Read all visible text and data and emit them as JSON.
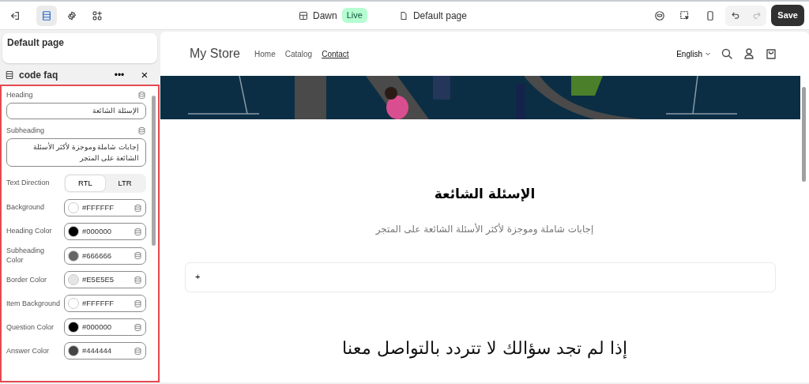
{
  "topbar": {
    "tools": [
      {
        "kind": "exit",
        "selected": false
      },
      {
        "kind": "sections",
        "selected": true
      },
      {
        "kind": "settings",
        "selected": false
      },
      {
        "kind": "apps",
        "selected": false
      }
    ],
    "theme": {
      "name": "Dawn",
      "badge": "Live"
    },
    "page": "Default page",
    "undo": {
      "disabled": false
    },
    "redo": {
      "disabled": true
    },
    "save": "Save"
  },
  "sidebar": {
    "page_title": "Default page",
    "section": {
      "title": "code faq",
      "menu": "•••",
      "close": "×"
    },
    "settings": [
      {
        "kind": "text",
        "label": "Heading",
        "value": "الإسئلة الشائعة"
      },
      {
        "kind": "textarea",
        "label": "Subheading",
        "value": "إجابات شاملة وموجزة لأكثر الأسئلة الشائعة على المتجر"
      },
      {
        "kind": "toggle",
        "label": "Text Direction",
        "options": [
          {
            "label": "RTL",
            "selected": true
          },
          {
            "label": "LTR",
            "selected": false
          }
        ]
      },
      {
        "kind": "color",
        "label": "Background",
        "value": "#FFFFFF",
        "color": "#ffffff"
      },
      {
        "kind": "color",
        "label": "Heading Color",
        "value": "#000000",
        "color": "#000000"
      },
      {
        "kind": "color",
        "label": "Subheading Color",
        "value": "#666666",
        "color": "#666666"
      },
      {
        "kind": "color",
        "label": "Border Color",
        "value": "#E5E5E5",
        "color": "#e5e5e5"
      },
      {
        "kind": "color",
        "label": "Item Background",
        "value": "#FFFFFF",
        "color": "#ffffff"
      },
      {
        "kind": "color",
        "label": "Question Color",
        "value": "#000000",
        "color": "#000000"
      },
      {
        "kind": "color",
        "label": "Answer Color",
        "value": "#444444",
        "color": "#444444"
      }
    ]
  },
  "preview": {
    "logo": "My Store",
    "nav": [
      {
        "label": "Home",
        "selected": false
      },
      {
        "label": "Catalog",
        "selected": false
      },
      {
        "label": "Contact",
        "selected": true
      }
    ],
    "language": "English",
    "faq": {
      "heading": "الإسئلة الشائعة",
      "subheading": "إجابات شاملة وموجزة لأكثر الأسئلة الشائعة على المتجر",
      "items": [
        {
          "toggle": "+"
        }
      ]
    },
    "contact_heading": "إذا لم تجد سؤالك لا تتردد بالتواصل معنا"
  }
}
